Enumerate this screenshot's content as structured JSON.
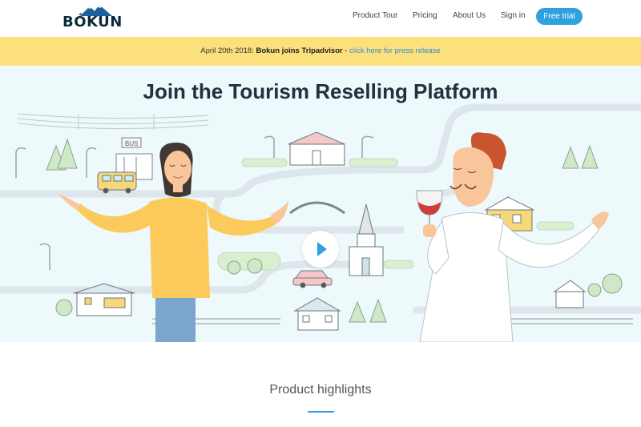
{
  "brand": {
    "name": "BÓKUN",
    "logo_icon": "mountain-icon"
  },
  "nav": {
    "items": [
      "Product Tour",
      "Pricing",
      "About Us",
      "Sign in"
    ],
    "cta": "Free trial"
  },
  "banner": {
    "date": "April 20th 2018:",
    "headline": "Bokun joins Tripadvisor",
    "sep": "-",
    "link": "click here for press release"
  },
  "hero": {
    "title": "Join the Tourism Reselling Platform",
    "bus_sign": "BUS",
    "play_icon": "play-icon"
  },
  "highlights": {
    "title": "Product highlights"
  },
  "colors": {
    "accent": "#2fa1df",
    "banner": "#fbe07b",
    "hero_bg": "#eef9fc",
    "title": "#24303e"
  }
}
